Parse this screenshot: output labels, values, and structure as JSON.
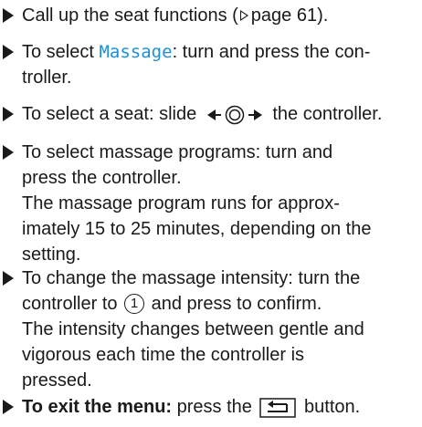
{
  "items": [
    {
      "a": "Call up the seat functions (",
      "ref": "page 61",
      "b": ")."
    },
    {
      "a": "To select ",
      "hl": "Massage",
      "b": ": turn and press the con-",
      "c": "troller."
    },
    {
      "a": "To select a seat: slide ",
      "b": " the controller."
    },
    {
      "a": "To select massage programs: turn and",
      "b": "press the controller.",
      "c": "The massage program runs for approx-",
      "d": "imately 15 to 25 minutes, depending on the",
      "e": "setting."
    },
    {
      "a": "To change the massage intensity: turn the",
      "b": "controller to ",
      "num": "1",
      "c": " and press to confirm.",
      "d": "The intensity changes between gentle and",
      "e": "vigorous each time the controller is",
      "f": "pressed."
    },
    {
      "bold": "To exit the menu:",
      "a": " press the ",
      "b": " button."
    }
  ]
}
